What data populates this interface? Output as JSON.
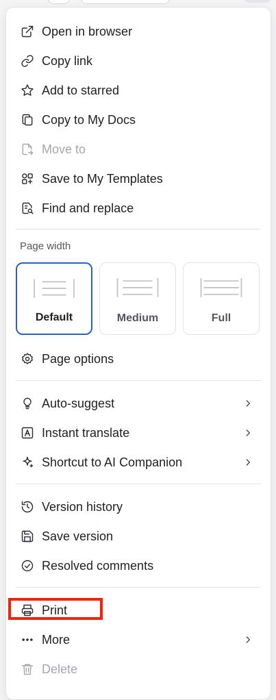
{
  "menu": {
    "items_top": [
      {
        "label": "Open in browser",
        "icon": "external-link-icon",
        "disabled": false
      },
      {
        "label": "Copy link",
        "icon": "link-icon",
        "disabled": false
      },
      {
        "label": "Add to starred",
        "icon": "star-icon",
        "disabled": false
      },
      {
        "label": "Copy to My Docs",
        "icon": "copy-icon",
        "disabled": false
      },
      {
        "label": "Move to",
        "icon": "move-file-icon",
        "disabled": true
      },
      {
        "label": "Save to My Templates",
        "icon": "templates-icon",
        "disabled": false
      },
      {
        "label": "Find and replace",
        "icon": "find-replace-icon",
        "disabled": false
      }
    ],
    "page_width": {
      "label": "Page width",
      "options": [
        "Default",
        "Medium",
        "Full"
      ],
      "selected": "Default"
    },
    "page_options": {
      "label": "Page options",
      "icon": "gear-icon"
    },
    "items_ai": [
      {
        "label": "Auto-suggest",
        "icon": "lightbulb-icon",
        "submenu": true
      },
      {
        "label": "Instant translate",
        "icon": "translate-icon",
        "submenu": true
      },
      {
        "label": "Shortcut to AI Companion",
        "icon": "sparkle-icon",
        "submenu": true
      }
    ],
    "items_version": [
      {
        "label": "Version history",
        "icon": "history-icon"
      },
      {
        "label": "Save version",
        "icon": "save-icon"
      },
      {
        "label": "Resolved comments",
        "icon": "check-circle-icon"
      }
    ],
    "items_bottom": [
      {
        "label": "Print",
        "icon": "printer-icon",
        "submenu": false,
        "disabled": false,
        "highlighted": true
      },
      {
        "label": "More",
        "icon": "more-icon",
        "submenu": true,
        "disabled": false
      },
      {
        "label": "Delete",
        "icon": "trash-icon",
        "submenu": false,
        "disabled": true
      }
    ]
  },
  "colors": {
    "accent": "#2860c8",
    "highlight": "#f1230b",
    "disabled_text": "#a6a6ac"
  }
}
